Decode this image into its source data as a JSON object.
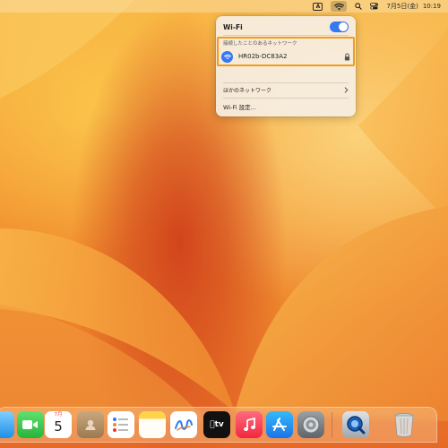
{
  "menubar": {
    "input_indicator": "A",
    "date": "7月5日(金)",
    "time": "10:19"
  },
  "wifi_menu": {
    "title": "Wi-Fi",
    "toggle_on": true,
    "known_networks_label": "接続したことのあるネットワーク",
    "known_network": {
      "name": "HR02b-DC83A2",
      "secured": true,
      "connected": true
    },
    "other_networks_label": "ほかのネットワーク",
    "settings_label": "Wi-Fi 設定..."
  },
  "dock": {
    "calendar_month": "7月",
    "calendar_day": "5",
    "items": [
      "finder-partial-icon",
      "facetime-icon",
      "calendar-icon",
      "contacts-icon",
      "reminders-icon",
      "notes-icon",
      "freeform-icon",
      "apple-tv-icon",
      "music-icon",
      "app-store-icon",
      "system-settings-icon",
      "quicktime-icon",
      "trash-icon"
    ]
  },
  "colors": {
    "accent": "#3478f6",
    "highlight_box": "#f49b19",
    "wallpaper_light": "#f8b443",
    "wallpaper_dark": "#d2451c"
  }
}
